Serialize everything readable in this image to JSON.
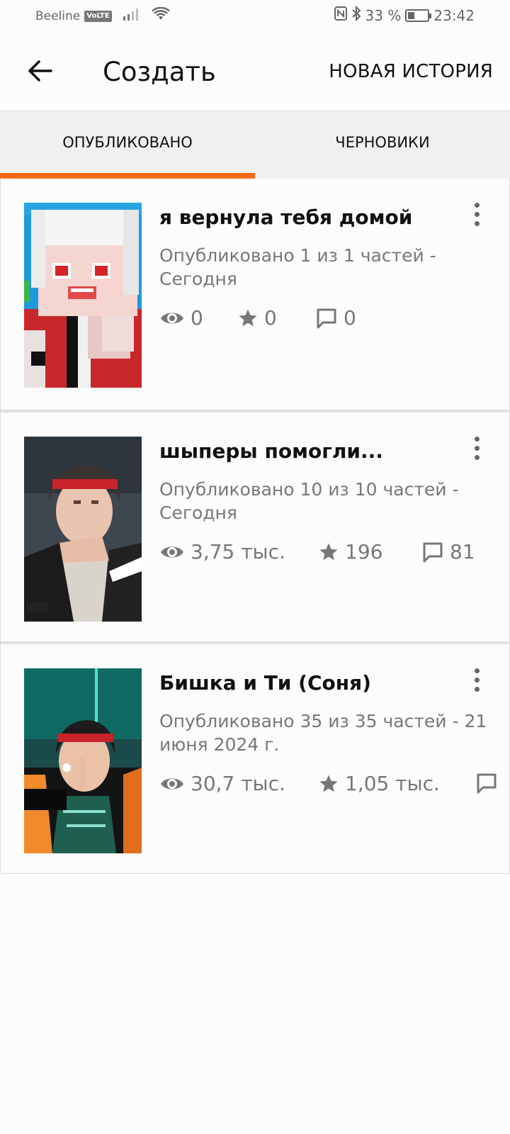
{
  "status_bar": {
    "carrier": "Beeline",
    "volte": "VoLTE",
    "battery": "33 %",
    "battery_level": 0.33,
    "time": "23:42"
  },
  "header": {
    "title": "Создать",
    "new_story": "НОВАЯ ИСТОРИЯ"
  },
  "tabs": [
    {
      "label": "ОПУБЛИКОВАНО",
      "active": true
    },
    {
      "label": "ЧЕРНОВИКИ",
      "active": false
    }
  ],
  "colors": {
    "accent": "#ff6b1a",
    "text_primary": "#111111",
    "text_secondary": "#777777",
    "tab_background": "#f1f0f0"
  },
  "stories": [
    {
      "title": "я вернула тебя домой",
      "meta": "Опубликовано 1 из 1 частей - Сегодня",
      "reads": "0",
      "votes": "0",
      "comments": "0"
    },
    {
      "title": "шыперы помогли...",
      "meta": "Опубликовано 10 из 10 частей - Сегодня",
      "reads": "3,75 тыс.",
      "votes": "196",
      "comments": "81"
    },
    {
      "title": "Бишка и Ти (Соня)",
      "meta": "Опубликовано 35 из 35 частей - 21 июня 2024 г.",
      "reads": "30,7 тыс.",
      "votes": "1,05 тыс.",
      "comments": ""
    }
  ]
}
